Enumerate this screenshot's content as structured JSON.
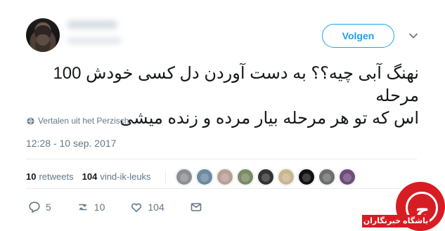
{
  "tweet": {
    "follow_label": "Volgen",
    "text": "نهنگ آبی چیه؟؟ به دست آوردن دل کسی خودش 100 مرحله\nاس که تو هر مرحله بیار مرده و زنده میشی",
    "translate_label": "Vertalen uit het Perzisch",
    "timestamp": "12:28 - 10 sep. 2017"
  },
  "stats": {
    "retweets_count": "10",
    "retweets_label": "retweets",
    "likes_count": "104",
    "likes_label": "vind-ik-leuks"
  },
  "liker_avatars": [
    {
      "color": "#8c8f92"
    },
    {
      "color": "#6c8aa1"
    },
    {
      "color": "#ba9f96"
    },
    {
      "color": "#7a8b65"
    },
    {
      "color": "#333333"
    },
    {
      "color": "#c8b68e"
    },
    {
      "color": "#111111"
    },
    {
      "color": "#6d6d6d"
    },
    {
      "color": "#6e4c7a"
    }
  ],
  "actions": {
    "reply_count": "5",
    "retweet_count": "10",
    "like_count": "104"
  },
  "watermark": {
    "text": "باشگاه خبرنگاران",
    "letter": "ج"
  },
  "colors": {
    "accent": "#1da1f2",
    "muted": "#657786",
    "watermark": "#d81c24"
  },
  "icons": {
    "menu": "chevron-down-icon",
    "translate": "globe-icon",
    "reply": "reply-icon",
    "retweet": "retweet-icon",
    "like": "heart-icon",
    "message": "message-icon"
  }
}
